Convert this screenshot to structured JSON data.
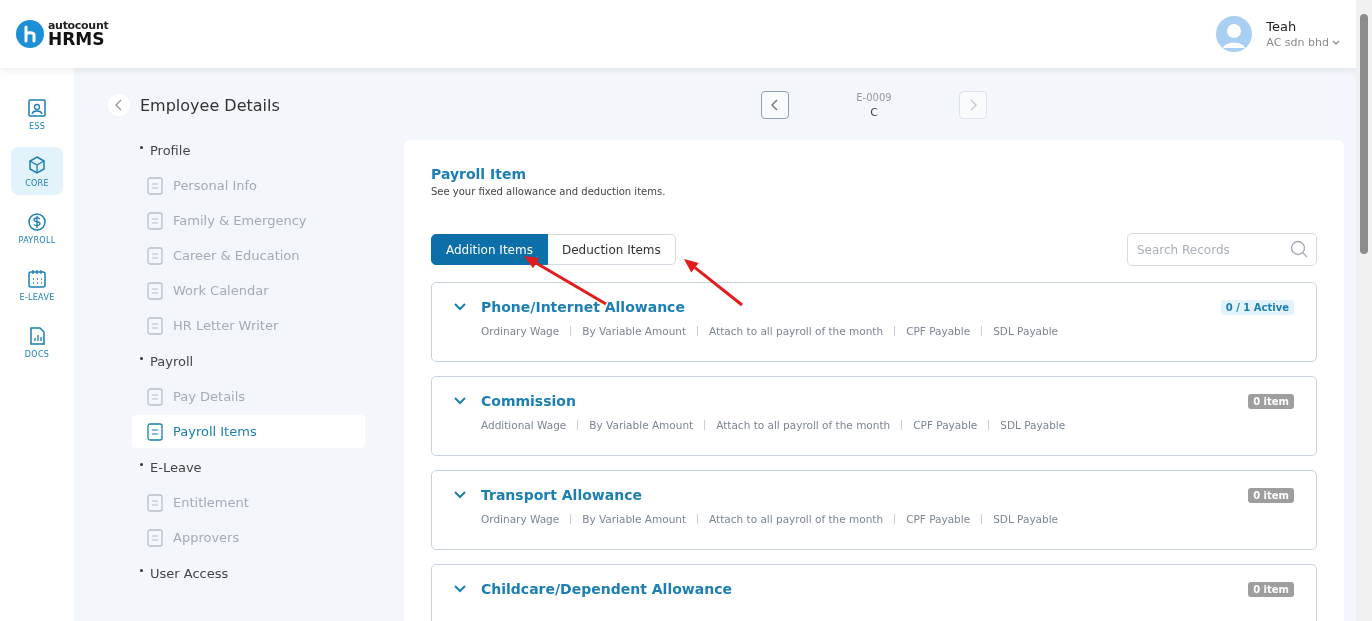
{
  "header": {
    "logo_small": "autocount",
    "logo_main": "HRMS",
    "user": {
      "name": "Teah",
      "company": "AC sdn bhd"
    }
  },
  "rail": [
    {
      "label": "ESS",
      "selected": false
    },
    {
      "label": "CORE",
      "selected": true
    },
    {
      "label": "PAYROLL",
      "selected": false
    },
    {
      "label": "E-LEAVE",
      "selected": false
    },
    {
      "label": "DOCS",
      "selected": false
    }
  ],
  "sidebar": {
    "title": "Employee Details",
    "sections": [
      {
        "label": "Profile",
        "items": [
          {
            "label": "Personal Info",
            "selected": false
          },
          {
            "label": "Family & Emergency",
            "selected": false
          },
          {
            "label": "Career & Education",
            "selected": false
          },
          {
            "label": "Work Calendar",
            "selected": false
          },
          {
            "label": "HR Letter Writer",
            "selected": false
          }
        ]
      },
      {
        "label": "Payroll",
        "items": [
          {
            "label": "Pay Details",
            "selected": false
          },
          {
            "label": "Payroll Items",
            "selected": true
          }
        ]
      },
      {
        "label": "E-Leave",
        "items": [
          {
            "label": "Entitlement",
            "selected": false
          },
          {
            "label": "Approvers",
            "selected": false
          }
        ]
      },
      {
        "label": "User Access"
      }
    ]
  },
  "record_nav": {
    "code": "E-0009",
    "name": "C",
    "prev_disabled": false,
    "next_disabled": true
  },
  "panel": {
    "title": "Payroll Item",
    "subtitle": "See your fixed allowance and deduction items.",
    "tabs": [
      {
        "label": "Addition Items",
        "selected": true
      },
      {
        "label": "Deduction Items",
        "selected": false
      }
    ],
    "search": {
      "placeholder": "Search Records"
    },
    "items": [
      {
        "title": "Phone/Internet Allowance",
        "badge": "0 / 1 Active",
        "kind": "active",
        "meta": [
          "Ordinary Wage",
          "By Variable Amount",
          "Attach to all payroll of the month",
          "CPF Payable",
          "SDL Payable"
        ]
      },
      {
        "title": "Commission",
        "badge": "0 item",
        "kind": "empty",
        "meta": [
          "Additional Wage",
          "By Variable Amount",
          "Attach to all payroll of the month",
          "CPF Payable",
          "SDL Payable"
        ]
      },
      {
        "title": "Transport Allowance",
        "badge": "0 item",
        "kind": "empty",
        "meta": [
          "Ordinary Wage",
          "By Variable Amount",
          "Attach to all payroll of the month",
          "CPF Payable",
          "SDL Payable"
        ]
      },
      {
        "title": "Childcare/Dependent Allowance",
        "badge": "0 item",
        "kind": "empty"
      }
    ]
  },
  "annotations": [
    {
      "kind": "arrow"
    },
    {
      "kind": "arrow"
    }
  ]
}
